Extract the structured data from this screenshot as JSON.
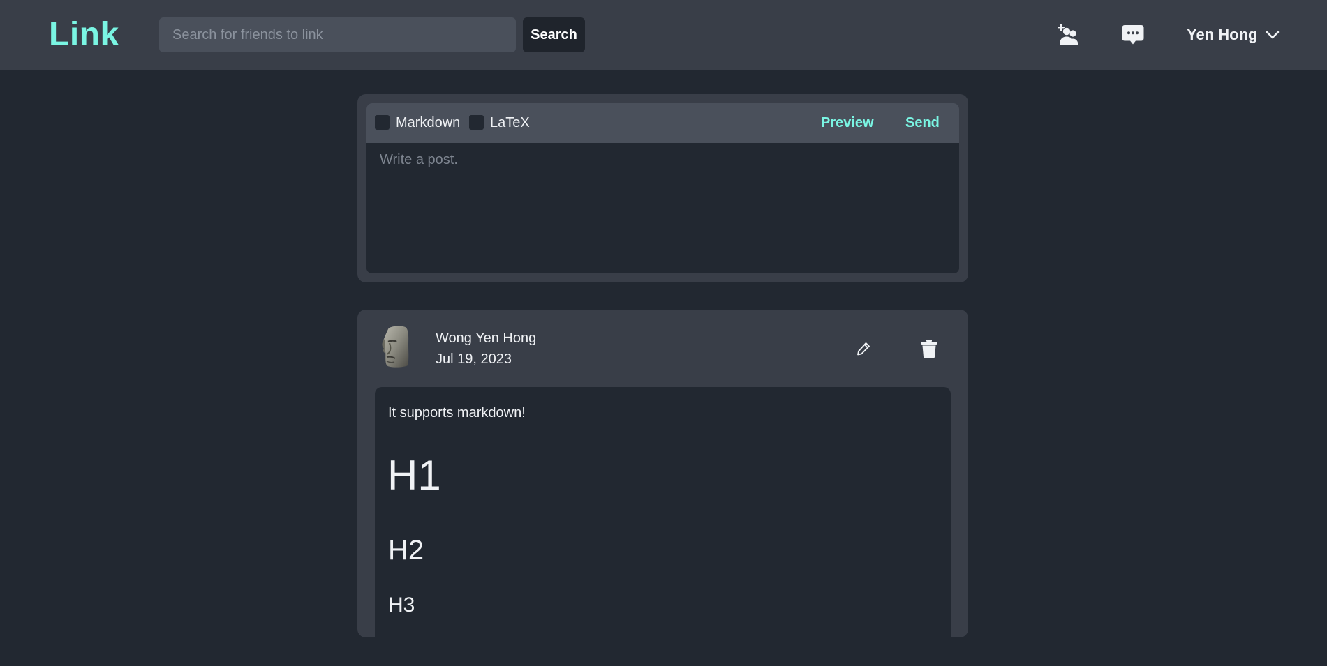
{
  "header": {
    "logo": "Link",
    "search": {
      "placeholder": "Search for friends to link",
      "value": "",
      "button_label": "Search"
    },
    "icons": [
      "add-friend-icon",
      "chat-icon"
    ],
    "user": {
      "name": "Yen Hong",
      "menu_icon": "chevron-down-icon"
    }
  },
  "composer": {
    "options": [
      {
        "label": "Markdown",
        "checked": false
      },
      {
        "label": "LaTeX",
        "checked": false
      }
    ],
    "preview_label": "Preview",
    "send_label": "Send",
    "placeholder": "Write a post.",
    "value": ""
  },
  "post": {
    "author": "Wong Yen Hong",
    "date": "Jul 19, 2023",
    "avatar_icon": "moai-avatar",
    "actions": [
      "edit-icon",
      "delete-icon"
    ],
    "body": {
      "paragraph": "It supports markdown!",
      "h1": "H1",
      "h2": "H2",
      "h3": "H3"
    }
  },
  "colors": {
    "accent": "#7af5e3",
    "background": "#222831",
    "surface": "#393e48",
    "toolbar": "#4a505b"
  }
}
